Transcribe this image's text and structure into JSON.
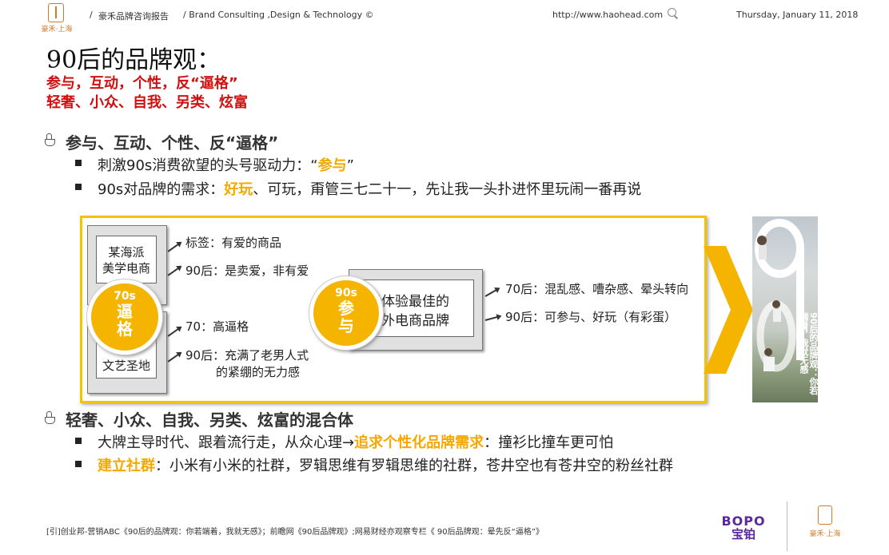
{
  "header": {
    "logo_text": "豪禾·上海",
    "slash1": "/",
    "company": "豪禾品牌咨询报告",
    "tagline": "/ Brand Consulting ,Design & Technology ©",
    "url": "http://www.haohead.com",
    "date": "Thursday, January 11, 2018"
  },
  "title": "90后的品牌观：",
  "red_lines": [
    "参与，互动，个性，反“逼格”",
    "轻奢、小众、自我、另类、炫富"
  ],
  "section1": {
    "heading": "参与、互动、个性、反“逼格”",
    "bullets": [
      {
        "pre": "刺激90s消费欲望的头号驱动力：“",
        "hl": "参与",
        "post": "”"
      },
      {
        "pre": "90s对品牌的需求：",
        "hl": "好玩",
        "post": "、可玩，甭管三七二十一，先让我一头扑进怀里玩闹一番再说"
      }
    ]
  },
  "diagram": {
    "box1": [
      "某海派",
      "美学电商"
    ],
    "box2": [
      "…",
      "文艺圣地"
    ],
    "circle1": {
      "top": "70s",
      "line1": "逼",
      "line2": "格"
    },
    "circle2": {
      "top": "90s",
      "line1": "参",
      "line2": "与"
    },
    "box3": [
      "后体验最佳的",
      "内外电商品牌"
    ],
    "labels_left": [
      "标签：有爱的商品",
      "90后：是卖爱，非有爱",
      "70：高逼格",
      "90后：充满了老男人式",
      "的紧绷的无力感"
    ],
    "labels_right": [
      "70后：混乱感、嘈杂感、晕头转向",
      "90后：可参与、好玩（有彩蛋）"
    ],
    "photo_caption": [
      "90后的品牌观：",
      "你若端着，我就无感"
    ],
    "accent_color": "#f5b400"
  },
  "section2": {
    "heading": "轻奢、小众、自我、另类、炫富的混合体",
    "bullets": [
      {
        "pre": "大牌主导时代、跟着流行走，从众心理→",
        "hl": "追求个性化品牌需求",
        "post": "：撞衫比撞车更可怕"
      },
      {
        "pre": "",
        "hl": "建立社群",
        "post": "：小米有小米的社群，罗辑思维有罗辑思维的社群，苍井空也有苍井空的粉丝社群"
      }
    ]
  },
  "footer": {
    "citation": "[引]创业邦-营销ABC《90后的品牌观：你若端着，我就无感》；前瞻网《90后品牌观》;网易财经亦观察专栏《 90后品牌观：晕先反“逼格”》",
    "bopo_top": "BOPO",
    "bopo_bottom": "宝铂",
    "logo_text": "豪禾·上海"
  }
}
